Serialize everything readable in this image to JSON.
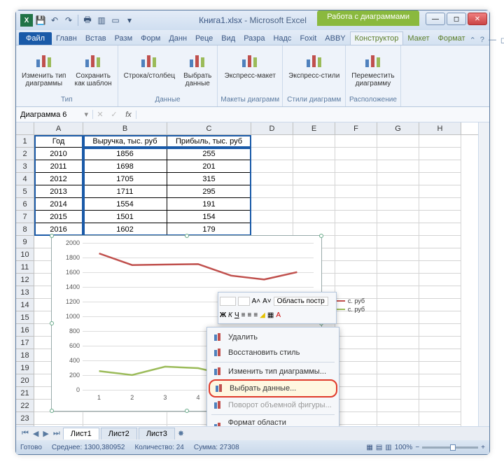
{
  "window": {
    "filename": "Книга1.xlsx",
    "app": "Microsoft Excel",
    "contextual_tools": "Работа с диаграммами"
  },
  "qat_icons": [
    "save",
    "undo",
    "redo",
    "print",
    "open",
    "new",
    "quickprint",
    "more"
  ],
  "tabs": {
    "file": "Файл",
    "items": [
      "Главн",
      "Встав",
      "Разм",
      "Форм",
      "Данн",
      "Реце",
      "Вид",
      "Разра",
      "Надс",
      "Foxit",
      "ABBY"
    ],
    "ctx": [
      "Конструктор",
      "Макет",
      "Формат"
    ],
    "active": "Конструктор"
  },
  "ribbon": {
    "groups": [
      {
        "label": "Тип",
        "buttons": [
          {
            "name": "change-chart-type",
            "text": "Изменить тип\nдиаграммы",
            "icon": "bar-icon"
          },
          {
            "name": "save-as-template",
            "text": "Сохранить\nкак шаблон",
            "icon": "bar-template-icon"
          }
        ]
      },
      {
        "label": "Данные",
        "buttons": [
          {
            "name": "switch-row-col",
            "text": "Строка/столбец",
            "icon": "swap-icon"
          },
          {
            "name": "select-data",
            "text": "Выбрать\nданные",
            "icon": "grid-icon"
          }
        ]
      },
      {
        "label": "Макеты диаграмм",
        "buttons": [
          {
            "name": "quick-layout",
            "text": "Экспресс-макет",
            "icon": "layout-icon"
          }
        ]
      },
      {
        "label": "Стили диаграмм",
        "buttons": [
          {
            "name": "quick-styles",
            "text": "Экспресс-стили",
            "icon": "styles-icon"
          }
        ]
      },
      {
        "label": "Расположение",
        "buttons": [
          {
            "name": "move-chart",
            "text": "Переместить\nдиаграмму",
            "icon": "move-icon"
          }
        ]
      }
    ]
  },
  "namebox": "Диаграмма 6",
  "columns": [
    "A",
    "B",
    "C",
    "D",
    "E",
    "F",
    "G",
    "H"
  ],
  "table": {
    "headers": [
      "Год",
      "Выручка, тыс. руб",
      "Прибыль, тыс. руб"
    ],
    "rows": [
      [
        "2010",
        "1856",
        "255"
      ],
      [
        "2011",
        "1698",
        "201"
      ],
      [
        "2012",
        "1705",
        "315"
      ],
      [
        "2013",
        "1711",
        "295"
      ],
      [
        "2014",
        "1554",
        "191"
      ],
      [
        "2015",
        "1501",
        "154"
      ],
      [
        "2016",
        "1602",
        "179"
      ]
    ]
  },
  "chart_data": {
    "type": "line",
    "categories": [
      1,
      2,
      3,
      4,
      5,
      6,
      7
    ],
    "series": [
      {
        "name": "Выручка, тыс. руб",
        "values": [
          1856,
          1698,
          1705,
          1711,
          1554,
          1501,
          1602
        ],
        "color": "#c0504d"
      },
      {
        "name": "Прибыль, тыс. руб",
        "values": [
          255,
          201,
          315,
          295,
          191,
          154,
          179
        ],
        "color": "#9bbb59"
      }
    ],
    "ylim": [
      0,
      2000
    ],
    "ystep": 200,
    "xlabel": "",
    "ylabel": "",
    "title": "",
    "legend_pos": "right",
    "legend_abbrev": "с. руб"
  },
  "mini_toolbar": {
    "font_size_label": "A˄ A˅",
    "area_label": "Область постр",
    "buttons": [
      "bold",
      "italic",
      "underline",
      "align-left",
      "align-center",
      "align-right",
      "fill",
      "border",
      "font-color"
    ]
  },
  "context_menu": {
    "items": [
      {
        "name": "delete",
        "label": "Удалить",
        "icon": "x-icon"
      },
      {
        "name": "reset-style",
        "label": "Восстановить стиль",
        "icon": "reset-icon"
      },
      {
        "sep": true
      },
      {
        "name": "change-type",
        "label": "Изменить тип диаграммы...",
        "icon": "bar-icon"
      },
      {
        "name": "select-data",
        "label": "Выбрать данные...",
        "icon": "grid-icon",
        "highlight": true
      },
      {
        "name": "3d-rotation",
        "label": "Поворот объемной фигуры...",
        "icon": "rotate-icon",
        "disabled": true
      },
      {
        "sep": true
      },
      {
        "name": "format-plot-area",
        "label": "Формат области построения...",
        "icon": "format-icon"
      }
    ]
  },
  "sheets": {
    "active": "Лист1",
    "others": [
      "Лист2",
      "Лист3"
    ]
  },
  "status": {
    "mode": "Готово",
    "avg_label": "Среднее:",
    "avg": "1300,380952",
    "count_label": "Количество:",
    "count": "24",
    "sum_label": "Сумма:",
    "sum": "27308",
    "zoom": "100%"
  }
}
